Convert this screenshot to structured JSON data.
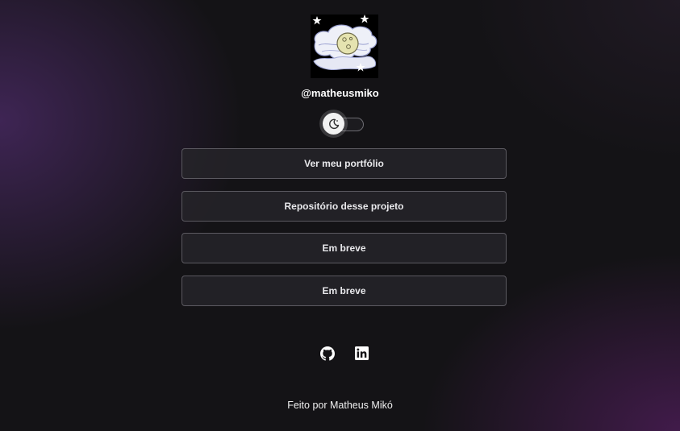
{
  "profile": {
    "username": "@matheusmiko",
    "avatar_icon": "moon-clouds-avatar"
  },
  "theme_toggle": {
    "icon": "moon-icon",
    "state": "dark"
  },
  "links": [
    {
      "label": "Ver meu portfólio"
    },
    {
      "label": "Repositório desse projeto"
    },
    {
      "label": "Em breve"
    },
    {
      "label": "Em breve"
    }
  ],
  "social": [
    {
      "icon": "github-icon"
    },
    {
      "icon": "linkedin-icon"
    }
  ],
  "footer": {
    "text": "Feito por Matheus Mikó"
  },
  "colors": {
    "background": "#141316",
    "button_bg": "#26242a",
    "button_border": "#5b5960",
    "accent_purple": "#46285f"
  }
}
